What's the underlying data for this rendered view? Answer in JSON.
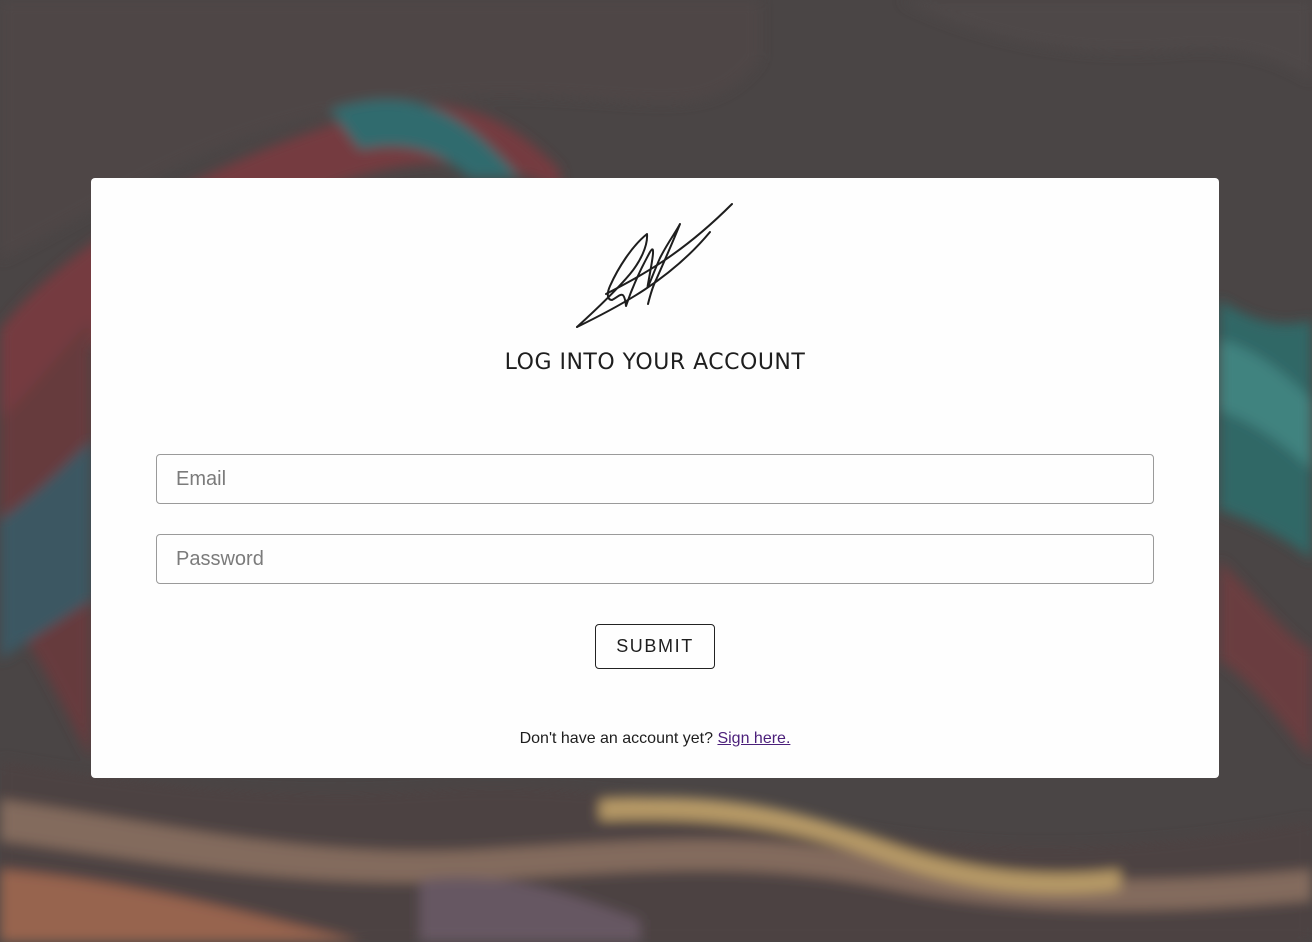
{
  "page": {
    "title": "LOG INTO YOUR ACCOUNT"
  },
  "logo": {
    "icon": "signature-logo"
  },
  "form": {
    "email_placeholder": "Email",
    "password_placeholder": "Password",
    "submit_label": "SUBMIT"
  },
  "signup": {
    "prompt": "Don't have an account yet?",
    "link_label": "Sign here."
  },
  "colors": {
    "background": "#4a4444",
    "card": "#fefefe",
    "text": "#1e1e1e",
    "link": "#4b1f7a",
    "border": "#9a9a9a"
  }
}
